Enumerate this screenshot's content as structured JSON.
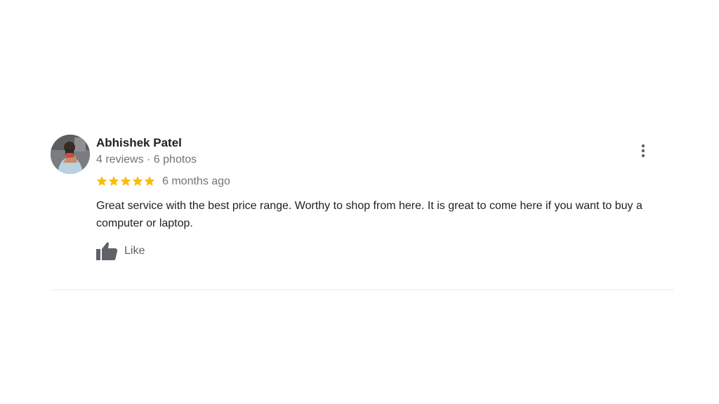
{
  "review": {
    "author": {
      "name": "Abhishek Patel",
      "meta": "4 reviews · 6 photos",
      "avatar_icon": "profile-photo"
    },
    "rating": {
      "stars": 5,
      "max_stars": 5,
      "star_color": "#fbbc04"
    },
    "date": "6 months ago",
    "text": "Great service with the best price range. Worthy to shop from here. It is great to come here if you want to buy a computer or laptop.",
    "actions": {
      "like_label": "Like",
      "like_icon": "thumbs-up-icon",
      "more_icon": "more-vert-icon"
    }
  },
  "colors": {
    "name_text": "#202124",
    "meta_text": "#70757a",
    "icon": "#5f6368",
    "divider": "#e8eaed"
  }
}
